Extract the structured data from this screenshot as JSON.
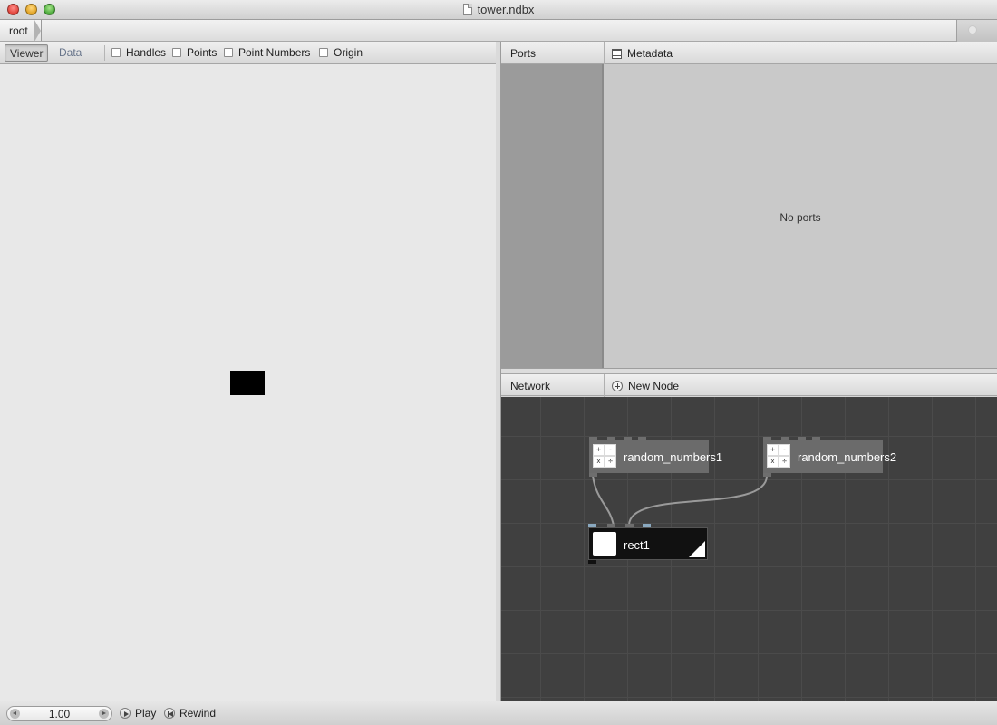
{
  "window": {
    "title": "tower.ndbx",
    "doc_icon": "document-icon"
  },
  "breadcrumb": {
    "root": "root"
  },
  "viewer": {
    "tabs": [
      "Viewer",
      "Data"
    ],
    "active_tab": "Viewer",
    "checkboxes": [
      {
        "label": "Handles",
        "checked": false
      },
      {
        "label": "Points",
        "checked": false
      },
      {
        "label": "Point Numbers",
        "checked": false
      },
      {
        "label": "Origin",
        "checked": false
      }
    ]
  },
  "ports": {
    "title": "Ports",
    "metadata_label": "Metadata",
    "empty_text": "No ports"
  },
  "network": {
    "title": "Network",
    "new_node_label": "New Node",
    "nodes": [
      {
        "name": "random_numbers1",
        "icon": [
          "+",
          "-",
          "x",
          "÷"
        ]
      },
      {
        "name": "random_numbers2",
        "icon": [
          "+",
          "-",
          "x",
          "÷"
        ]
      },
      {
        "name": "rect1",
        "rendered": true
      }
    ]
  },
  "playback": {
    "frame": "1.00",
    "play_label": "Play",
    "rewind_label": "Rewind"
  },
  "colors": {
    "network_bg": "#404040",
    "node_bg": "#6b6b6b",
    "rendered_node_bg": "#111111",
    "wire": "#9a9a9a"
  }
}
